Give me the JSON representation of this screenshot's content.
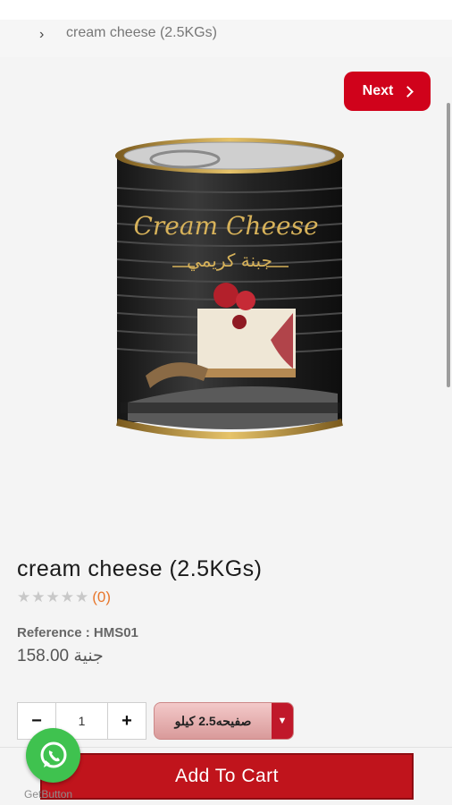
{
  "breadcrumb": {
    "separator": "›",
    "current": "cream cheese (2.5KGs)"
  },
  "nav": {
    "next_label": "Next"
  },
  "product": {
    "image_alt": "Cream Cheese can",
    "can_brand_text": "Cream Cheese",
    "can_arabic_text": "جبنة كريمي",
    "name": "cream cheese (2.5KGs)",
    "rating_stars": 0,
    "rating_max": 5,
    "review_count": "(0)",
    "reference_label": "Reference : ",
    "reference_value": "HMS01",
    "price": "158.00 جنية"
  },
  "purchase": {
    "quantity": "1",
    "minus_label": "−",
    "plus_label": "+",
    "variant_selected": "صفيحه2.5 كيلو",
    "add_to_cart_label": "Add To Cart"
  },
  "widget": {
    "getbutton_label": "GetButton"
  },
  "colors": {
    "accent": "#d0021b",
    "cart": "#c0141c",
    "whatsapp": "#3fc24f",
    "review": "#e8782e"
  }
}
